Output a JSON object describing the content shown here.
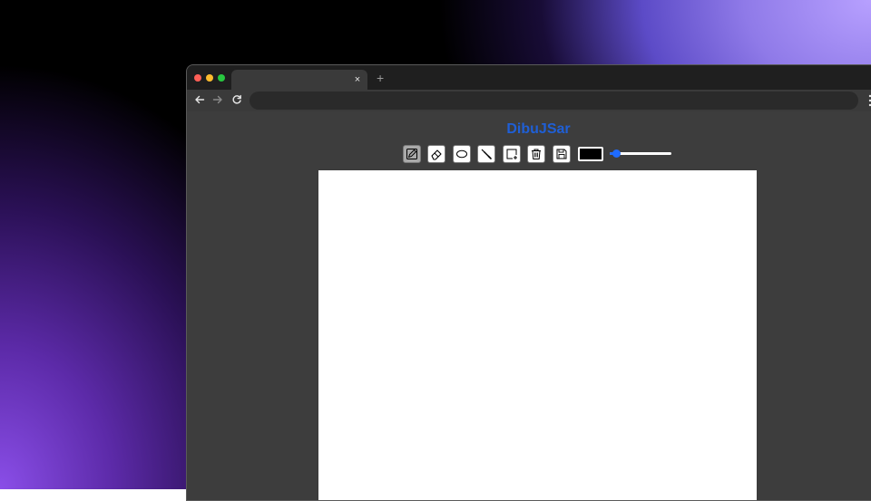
{
  "browser": {
    "tab_close": "×",
    "new_tab": "+"
  },
  "app": {
    "title": "DibuJSar",
    "tools": [
      {
        "icon": "pencil-icon",
        "active": true
      },
      {
        "icon": "eraser-icon",
        "active": false
      },
      {
        "icon": "ellipse-icon",
        "active": false
      },
      {
        "icon": "eyedropper-icon",
        "active": false
      },
      {
        "icon": "add-square-icon",
        "active": false
      },
      {
        "icon": "trash-icon",
        "active": false
      },
      {
        "icon": "save-icon",
        "active": false
      }
    ],
    "stroke_color": "#000000",
    "brush_size_fraction": 0.05
  },
  "colors": {
    "title": "#1f5fd6",
    "accent": "#1e6bff",
    "page_bg": "#3d3d3d",
    "canvas_bg": "#ffffff"
  }
}
